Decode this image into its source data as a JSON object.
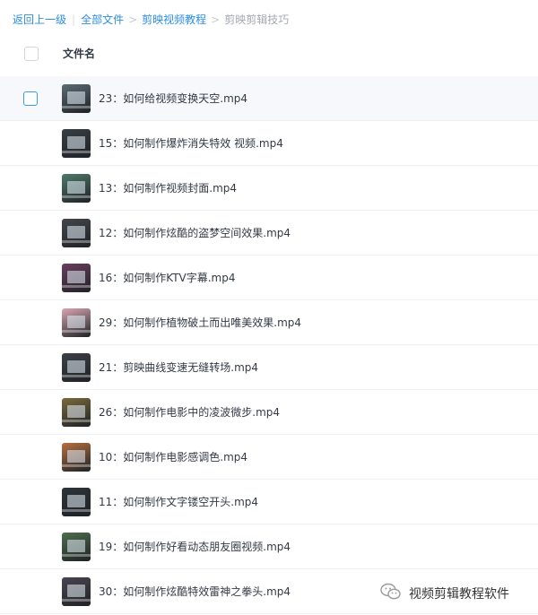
{
  "breadcrumb": {
    "back": "返回上一级",
    "separator": "|",
    "all_files": "全部文件",
    "arrow": ">",
    "folder": "剪映视频教程",
    "current": "剪映剪辑技巧"
  },
  "header": {
    "column_label": "文件名"
  },
  "files": [
    {
      "name": "23：如何给视频变换天空.mp4",
      "thumb_color": "#5c6b73"
    },
    {
      "name": "15：如何制作爆炸消失特效 视频.mp4",
      "thumb_color": "#3a3f44"
    },
    {
      "name": "13：如何制作视频封面.mp4",
      "thumb_color": "#4e7a6a"
    },
    {
      "name": "12：如何制作炫酷的盗梦空间效果.mp4",
      "thumb_color": "#44464a"
    },
    {
      "name": "16：如何制作KTV字幕.mp4",
      "thumb_color": "#6a3f5e"
    },
    {
      "name": "29：如何制作植物破土而出唯美效果.mp4",
      "thumb_color": "#d8a7b3"
    },
    {
      "name": "21：剪映曲线变速无缝转场.mp4",
      "thumb_color": "#3d4046"
    },
    {
      "name": "26：如何制作电影中的凌波微步.mp4",
      "thumb_color": "#7a6a3c"
    },
    {
      "name": "10：如何制作电影感调色.mp4",
      "thumb_color": "#b5703f"
    },
    {
      "name": "11：如何制作文字镂空开头.mp4",
      "thumb_color": "#2f3438"
    },
    {
      "name": "19：如何制作好看动态朋友圈视频.mp4",
      "thumb_color": "#4f6e4e"
    },
    {
      "name": "30：如何制作炫酷特效雷神之拳头.mp4",
      "thumb_color": "#4a4550"
    }
  ],
  "watermark": {
    "text": "视频剪辑教程软件",
    "icon": "wechat-icon"
  }
}
